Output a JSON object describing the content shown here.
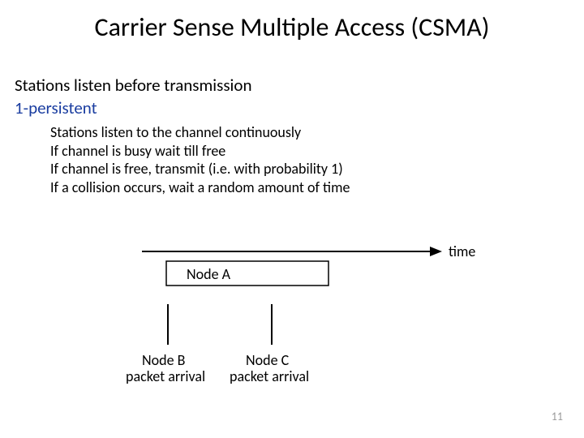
{
  "title": "Carrier Sense Multiple Access (CSMA)",
  "line1": "Stations listen before transmission",
  "line2": "1-persistent",
  "bullets": [
    "Stations listen to the channel continuously",
    "If channel is busy wait till free",
    "If channel is free, transmit (i.e. with probability 1)",
    "If a collision occurs, wait a random amount of time"
  ],
  "diagram": {
    "time_label": "time",
    "node_a": "Node A",
    "node_b_line1": "Node B",
    "node_b_line2": "packet arrival",
    "node_c_line1": "Node C",
    "node_c_line2": "packet arrival"
  },
  "page_number": "11"
}
